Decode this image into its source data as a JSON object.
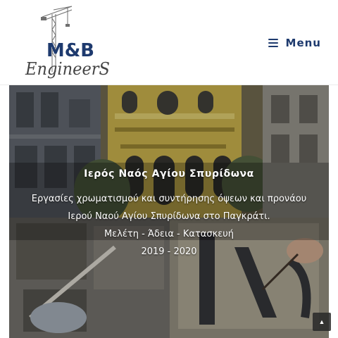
{
  "header": {
    "logo": {
      "letters": "M&B",
      "wordmark": "EngineerS"
    },
    "menu": {
      "icon": "hamburger-icon",
      "label": "Menu"
    }
  },
  "hero": {
    "title": "Ιερός Ναός Αγίου Σπυρίδωνα",
    "lines": [
      "Εργασίες χρωματισμού και συντήρησης όψεων και προνάου",
      "Ιερού Ναού Αγίου Σπυρίδωνα στο Παγκράτι.",
      "Μελέτη - Άδεια - Κατασκευή",
      "2019 - 2020"
    ]
  },
  "scroll_top": {
    "icon": "chevron-up-icon",
    "glyph": "▲"
  },
  "colors": {
    "brand_blue": "#1e3a6e",
    "header_bg": "#ffffff",
    "text_light": "#ffffff"
  }
}
